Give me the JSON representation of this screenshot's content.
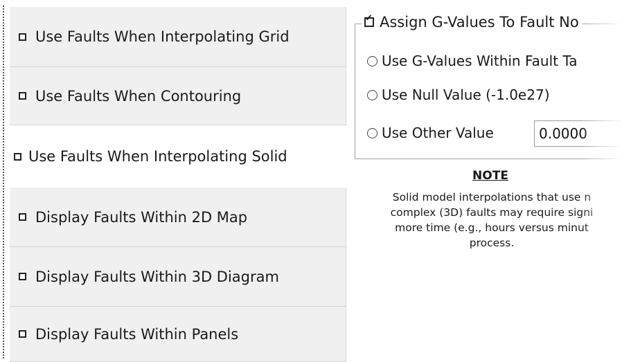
{
  "fault_options": [
    {
      "label": "Use Faults When Interpolating Grid",
      "checked": false
    },
    {
      "label": "Use Faults When Contouring",
      "checked": false
    },
    {
      "label": "Use Faults When Interpolating Solid",
      "checked": false
    },
    {
      "label": "Display Faults Within 2D Map",
      "checked": false
    },
    {
      "label": "Display Faults Within 3D Diagram",
      "checked": false
    },
    {
      "label": "Display Faults Within Panels",
      "checked": false
    }
  ],
  "gvalue_group": {
    "title": "Assign G-Values To Fault No",
    "title_checked": true,
    "options": [
      {
        "label": "Use G-Values Within Fault Ta",
        "selected": false
      },
      {
        "label": "Use Null Value (-1.0e27)",
        "selected": false
      },
      {
        "label": "Use Other Value",
        "selected": false
      }
    ],
    "other_value": "0.0000"
  },
  "note": {
    "title": "NOTE",
    "lines": [
      "Solid model interpolations that use n",
      "complex (3D) faults may require signi",
      "more time (e.g., hours versus minut",
      "process."
    ]
  }
}
